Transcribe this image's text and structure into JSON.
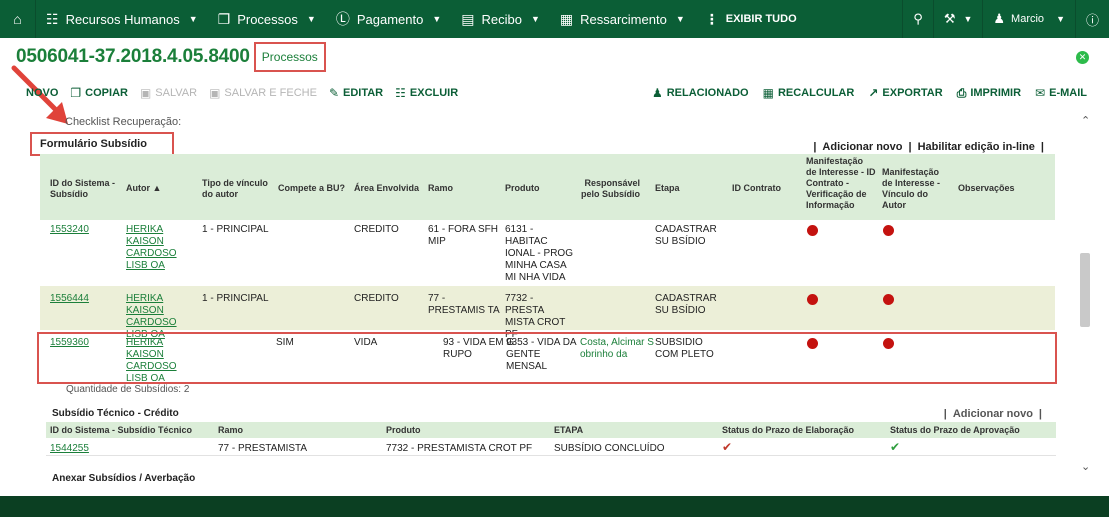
{
  "topbar": {
    "menus": [
      {
        "icon": "sitemap-icon",
        "label": "Recursos Humanos"
      },
      {
        "icon": "copy-icon",
        "label": "Processos"
      },
      {
        "icon": "dollar-icon",
        "label": "Pagamento"
      },
      {
        "icon": "receipt-icon",
        "label": "Recibo"
      },
      {
        "icon": "refund-icon",
        "label": "Ressarcimento"
      }
    ],
    "show_all": "EXIBIR TUDO",
    "user": "Marcio"
  },
  "title": {
    "process_number": "0506041-37.2018.4.05.8400",
    "tag": "Processos"
  },
  "toolbar": {
    "novo": "NOVO",
    "copiar": "COPIAR",
    "salvar": "SALVAR",
    "salvar_fechar": "SALVAR E FECHE",
    "editar": "EDITAR",
    "excluir": "EXCLUIR",
    "relacionado": "RELACIONADO",
    "recalcular": "RECALCULAR",
    "exportar": "EXPORTAR",
    "imprimir": "IMPRIMIR",
    "email": "E-MAIL"
  },
  "checklist_label": "Checklist Recuperação:",
  "form_subsidio": {
    "title": "Formulário Subsídio",
    "add_new": "Adicionar novo",
    "inline_edit": "Habilitar edição in-line",
    "columns": [
      "ID do Sistema - Subsídio",
      "Autor",
      "Tipo de vínculo do autor",
      "Compete a BU?",
      "Área Envolvida",
      "Ramo",
      "Produto",
      "Responsável pelo Subsídio",
      "Etapa",
      "ID Contrato",
      "Manifestação de Interesse - ID Contrato - Verificação de Informação",
      "Manifestação de Interesse - Vínculo do Autor",
      "Observações"
    ],
    "rows": [
      {
        "id": "1553240",
        "autor": "HERIKA KAISON CARDOSO LISB OA",
        "tipo": "1 - PRINCIPAL",
        "compete": "",
        "area": "CREDITO",
        "ramo": "61 - FORA SFH MIP",
        "produto": "6131 - HABITAC IONAL - PROG MINHA CASA MI NHA VIDA",
        "responsavel": "",
        "etapa": "CADASTRAR SU BSÍDIO"
      },
      {
        "id": "1556444",
        "autor": "HERIKA KAISON CARDOSO LISB OA",
        "tipo": "1 - PRINCIPAL",
        "compete": "",
        "area": "CREDITO",
        "ramo": "77 - PRESTAMIS TA",
        "produto": "7732 - PRESTA MISTA CROT PF",
        "responsavel": "",
        "etapa": "CADASTRAR SU BSÍDIO"
      },
      {
        "id": "1559360",
        "autor": "HERIKA KAISON CARDOSO LISB OA",
        "tipo": "",
        "compete": "SIM",
        "area": "VIDA",
        "ramo": "93 - VIDA EM G RUPO",
        "produto": "9353 - VIDA DA GENTE MENSAL",
        "responsavel": "Costa, Alcimar S obrinho da",
        "etapa": "SUBSIDIO COM PLETO"
      }
    ],
    "quantity": "Quantidade de Subsídios: 2"
  },
  "subsidio_tecnico": {
    "title": "Subsídio Técnico - Crédito",
    "add_new": "Adicionar novo",
    "columns": [
      "ID do Sistema - Subsídio Técnico",
      "Ramo",
      "Produto",
      "ETAPA",
      "Status do Prazo de Elaboração",
      "Status do Prazo de Aprovação"
    ],
    "row": {
      "id": "1544255",
      "ramo": "77 - PRESTAMISTA",
      "produto": "7732 - PRESTAMISTA CROT PF",
      "etapa": "SUBSÍDIO CONCLUÍDO"
    }
  },
  "anexar_title": "Anexar Subsídios / Averbação",
  "colors": {
    "brand": "#0b5e36",
    "link": "#1b7f3a",
    "highlight": "#d9534f",
    "status_red": "#c4120f"
  }
}
